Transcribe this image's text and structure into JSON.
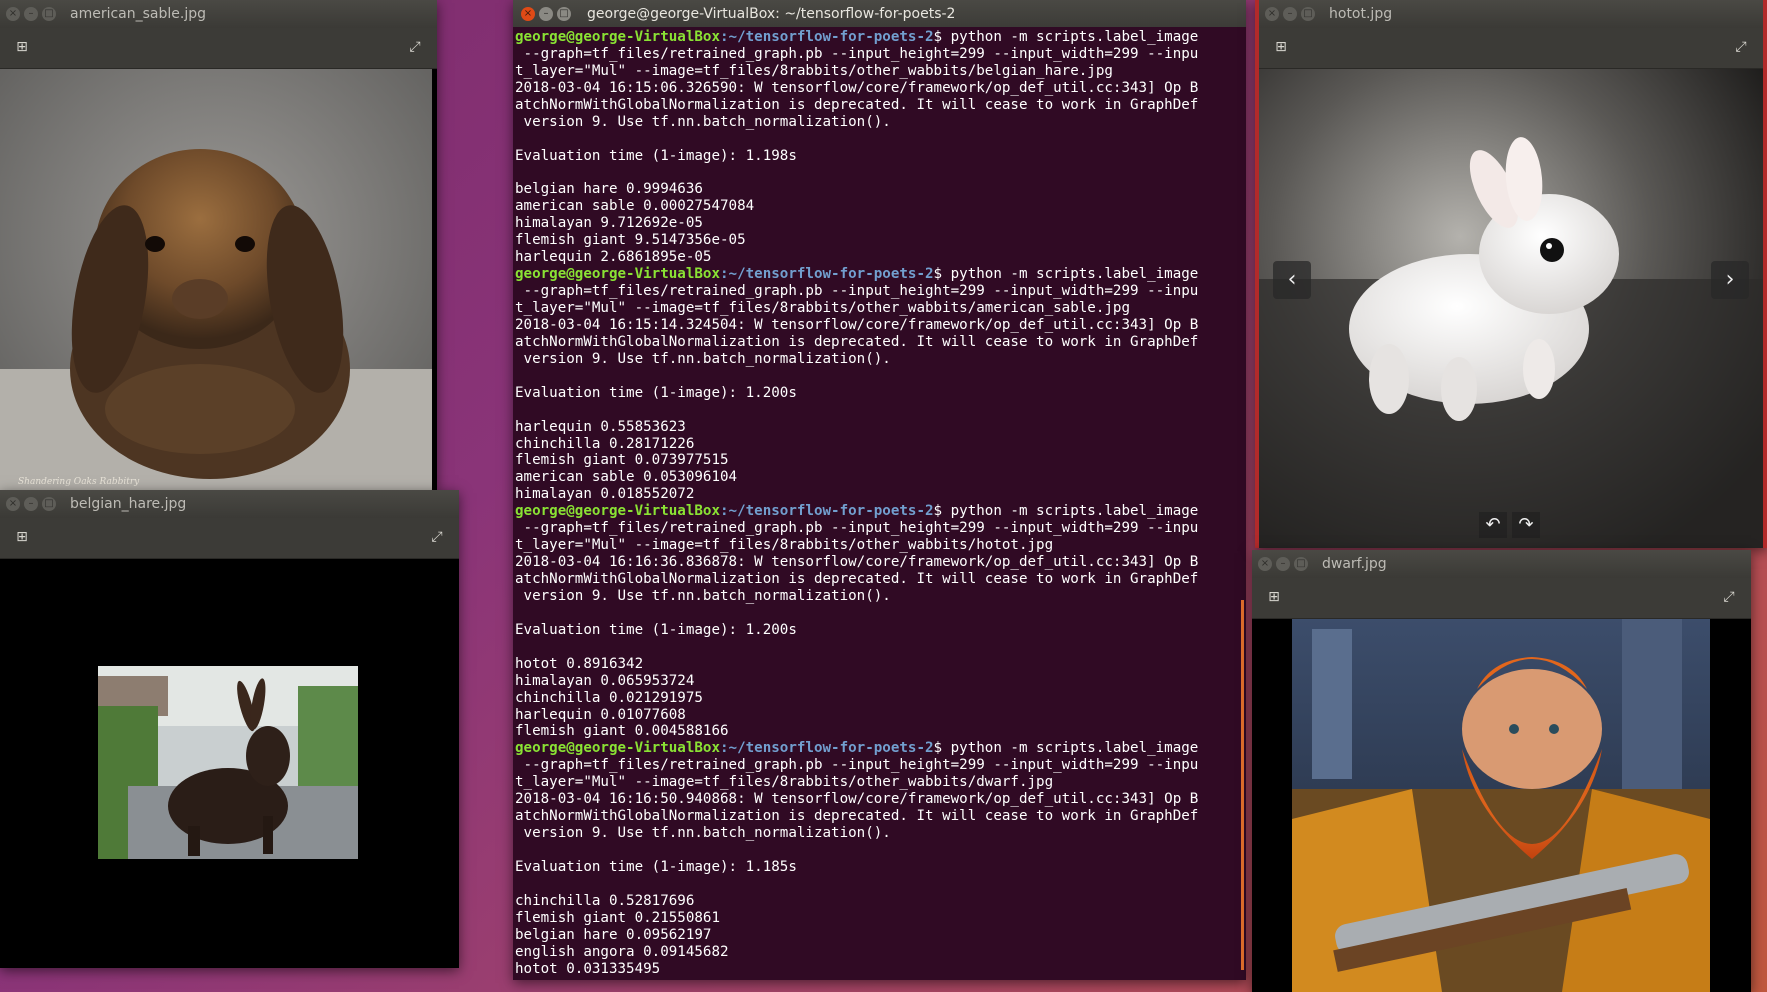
{
  "windows": {
    "american_sable": {
      "title": "american_sable.jpg",
      "signature": "Shandering Oaks Rabbitry"
    },
    "belgian_hare": {
      "title": "belgian_hare.jpg"
    },
    "hotot": {
      "title": "hotot.jpg"
    },
    "dwarf": {
      "title": "dwarf.jpg"
    }
  },
  "terminal": {
    "title": "george@george-VirtualBox: ~/tensorflow-for-poets-2",
    "prompt_user": "george@george-VirtualBox",
    "prompt_path": ":~/tensorflow-for-poets-2",
    "prompt_symbol": "$",
    "runs": [
      {
        "command": " python -m scripts.label_image",
        "command_cont": [
          " --graph=tf_files/retrained_graph.pb --input_height=299 --input_width=299 --inpu",
          "t_layer=\"Mul\" --image=tf_files/8rabbits/other_wabbits/belgian_hare.jpg"
        ],
        "warning": [
          "2018-03-04 16:15:06.326590: W tensorflow/core/framework/op_def_util.cc:343] Op B",
          "atchNormWithGlobalNormalization is deprecated. It will cease to work in GraphDef",
          " version 9. Use tf.nn.batch_normalization()."
        ],
        "eval": "Evaluation time (1-image): 1.198s",
        "results": [
          "belgian hare 0.9994636",
          "american sable 0.00027547084",
          "himalayan 9.712692e-05",
          "flemish giant 9.5147356e-05",
          "harlequin 2.6861895e-05"
        ]
      },
      {
        "command": " python -m scripts.label_image",
        "command_cont": [
          " --graph=tf_files/retrained_graph.pb --input_height=299 --input_width=299 --inpu",
          "t_layer=\"Mul\" --image=tf_files/8rabbits/other_wabbits/american_sable.jpg"
        ],
        "warning": [
          "2018-03-04 16:15:14.324504: W tensorflow/core/framework/op_def_util.cc:343] Op B",
          "atchNormWithGlobalNormalization is deprecated. It will cease to work in GraphDef",
          " version 9. Use tf.nn.batch_normalization()."
        ],
        "eval": "Evaluation time (1-image): 1.200s",
        "results": [
          "harlequin 0.55853623",
          "chinchilla 0.28171226",
          "flemish giant 0.073977515",
          "american sable 0.053096104",
          "himalayan 0.018552072"
        ]
      },
      {
        "command": " python -m scripts.label_image",
        "command_cont": [
          " --graph=tf_files/retrained_graph.pb --input_height=299 --input_width=299 --inpu",
          "t_layer=\"Mul\" --image=tf_files/8rabbits/other_wabbits/hotot.jpg"
        ],
        "warning": [
          "2018-03-04 16:16:36.836878: W tensorflow/core/framework/op_def_util.cc:343] Op B",
          "atchNormWithGlobalNormalization is deprecated. It will cease to work in GraphDef",
          " version 9. Use tf.nn.batch_normalization()."
        ],
        "eval": "Evaluation time (1-image): 1.200s",
        "results": [
          "hotot 0.8916342",
          "himalayan 0.065953724",
          "chinchilla 0.021291975",
          "harlequin 0.01077608",
          "flemish giant 0.004588166"
        ]
      },
      {
        "command": " python -m scripts.label_image",
        "command_cont": [
          " --graph=tf_files/retrained_graph.pb --input_height=299 --input_width=299 --inpu",
          "t_layer=\"Mul\" --image=tf_files/8rabbits/other_wabbits/dwarf.jpg"
        ],
        "warning": [
          "2018-03-04 16:16:50.940868: W tensorflow/core/framework/op_def_util.cc:343] Op B",
          "atchNormWithGlobalNormalization is deprecated. It will cease to work in GraphDef",
          " version 9. Use tf.nn.batch_normalization()."
        ],
        "eval": "Evaluation time (1-image): 1.185s",
        "results": [
          "chinchilla 0.52817696",
          "flemish giant 0.21550861",
          "belgian hare 0.09562197",
          "english angora 0.09145682",
          "hotot 0.031335495"
        ]
      }
    ]
  },
  "colors": {
    "terminal_bg": "#300a24",
    "prompt_user": "#8ae234",
    "prompt_path": "#729fcf",
    "titlebar": "#3c3b37"
  },
  "icons": {
    "window_close": "close-icon",
    "window_minimize": "minimize-icon",
    "window_maximize": "maximize-icon",
    "add": "add-icon",
    "fullscreen": "fullscreen-icon",
    "prev": "chevron-left-icon",
    "next": "chevron-right-icon",
    "rotate_left": "rotate-left-icon",
    "rotate_right": "rotate-right-icon"
  }
}
